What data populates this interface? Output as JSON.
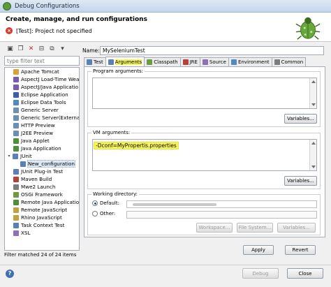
{
  "window": {
    "title": "Debug Configurations"
  },
  "header": {
    "title": "Create, manage, and run configurations",
    "error": "[Test]: Project not specified"
  },
  "left": {
    "filter_placeholder": "type filter text",
    "tree": [
      {
        "label": "Apache Tomcat",
        "icon": "tomcat-icon",
        "color": "#d9a338",
        "indent": 1
      },
      {
        "label": "AspectJ Load-Time Wea",
        "icon": "aspectj-icon",
        "color": "#7a5bb0",
        "indent": 1
      },
      {
        "label": "AspectJ/Java Applicatio",
        "icon": "aspectj-icon",
        "color": "#7a5bb0",
        "indent": 1
      },
      {
        "label": "Eclipse Application",
        "icon": "eclipse-icon",
        "color": "#3d5da8",
        "indent": 1
      },
      {
        "label": "Eclipse Data Tools",
        "icon": "datatools-icon",
        "color": "#4f8ac2",
        "indent": 1
      },
      {
        "label": "Generic Server",
        "icon": "server-icon",
        "color": "#6c8fb5",
        "indent": 1
      },
      {
        "label": "Generic Server(External",
        "icon": "server-icon",
        "color": "#6c8fb5",
        "indent": 1
      },
      {
        "label": "HTTP Preview",
        "icon": "server-icon",
        "color": "#6c8fb5",
        "indent": 1
      },
      {
        "label": "J2EE Preview",
        "icon": "server-icon",
        "color": "#6c8fb5",
        "indent": 1
      },
      {
        "label": "Java Applet",
        "icon": "applet-icon",
        "color": "#4f8f3a",
        "indent": 1
      },
      {
        "label": "Java Application",
        "icon": "java-app-icon",
        "color": "#4f8f3a",
        "indent": 1
      },
      {
        "label": "JUnit",
        "icon": "junit-icon",
        "color": "#5b7fb7",
        "indent": 0,
        "expanded": true
      },
      {
        "label": "New_configuration",
        "icon": "junit-config-icon",
        "color": "#5b7fb7",
        "indent": 2,
        "selected": true
      },
      {
        "label": "JUnit Plug-in Test",
        "icon": "junit-plugin-icon",
        "color": "#5b7fb7",
        "indent": 1
      },
      {
        "label": "Maven Build",
        "icon": "maven-icon",
        "color": "#b5413a",
        "indent": 1
      },
      {
        "label": "Mwe2 Launch",
        "icon": "mwe2-icon",
        "color": "#7d7d7d",
        "indent": 1
      },
      {
        "label": "OSGi Framework",
        "icon": "osgi-icon",
        "color": "#6e9a42",
        "indent": 1
      },
      {
        "label": "Remote Java Applicatio",
        "icon": "remote-java-icon",
        "color": "#4f8f3a",
        "indent": 1
      },
      {
        "label": "Remote JavaScript",
        "icon": "remote-js-icon",
        "color": "#c2a23d",
        "indent": 1
      },
      {
        "label": "Rhino JavaScript",
        "icon": "rhino-icon",
        "color": "#c2a23d",
        "indent": 1
      },
      {
        "label": "Task Context Test",
        "icon": "task-icon",
        "color": "#5b7fb7",
        "indent": 1
      },
      {
        "label": "XSL",
        "icon": "xsl-icon",
        "color": "#8e6fb8",
        "indent": 1
      }
    ],
    "status": "Filter matched 24 of 24 items"
  },
  "right": {
    "name_label": "Name:",
    "name_value": "MySeleniumTest",
    "tabs": [
      {
        "label": "Test",
        "icon": "test-tab-icon",
        "color": "#5b7fb7"
      },
      {
        "label": "Arguments",
        "icon": "arguments-tab-icon",
        "color": "#5b7fb7",
        "active": true
      },
      {
        "label": "Classpath",
        "icon": "classpath-tab-icon",
        "color": "#6e9a42"
      },
      {
        "label": "JRE",
        "icon": "jre-tab-icon",
        "color": "#b5413a"
      },
      {
        "label": "Source",
        "icon": "source-tab-icon",
        "color": "#8e6fb8"
      },
      {
        "label": "Environment",
        "icon": "environment-tab-icon",
        "color": "#4f8ac2"
      },
      {
        "label": "Common",
        "icon": "common-tab-icon",
        "color": "#7d7d7d"
      }
    ],
    "program_args_label": "Program arguments:",
    "variables1": "Variables...",
    "vm_args_label": "VM arguments:",
    "vm_args_value": "-Dconf=MyPropertis.properties",
    "variables2": "Variables...",
    "workdir_label": "Working directory:",
    "default_label": "Default:",
    "other_label": "Other:",
    "workspace_btn": "Workspace...",
    "filesystem_btn": "File System...",
    "variables3": "Variables...",
    "apply": "Apply",
    "revert": "Revert"
  },
  "footer": {
    "debug": "Debug",
    "close": "Close"
  }
}
